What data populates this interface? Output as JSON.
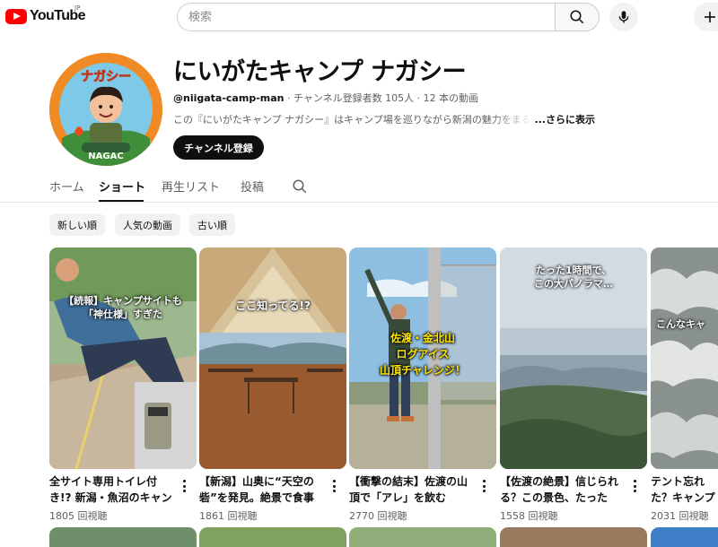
{
  "topbar": {
    "logo_text": "YouTube",
    "region": "JP",
    "search_placeholder": "検索"
  },
  "channel": {
    "name": "にいがたキャンプ ナガシー",
    "handle": "@niigata-camp-man",
    "stats": " ‧ チャンネル登録者数 105人 ‧ 12 本の動画",
    "description": "この『にいがたキャンプ ナガシー』はキャンプ場を巡りながら新潟の魅力をまるごと",
    "more_label": "...さらに表示",
    "subscribe_label": "チャンネル登録",
    "avatar_text_top": "ナガシー",
    "avatar_text_bottom": "NAGAC"
  },
  "tabs": [
    {
      "label": "ホーム"
    },
    {
      "label": "ショート"
    },
    {
      "label": "再生リスト"
    },
    {
      "label": "投稿"
    }
  ],
  "chips": [
    {
      "label": "新しい順"
    },
    {
      "label": "人気の動画"
    },
    {
      "label": "古い順"
    }
  ],
  "shorts": [
    {
      "title": "全サイト専用トイレ付き!? 新潟・魚沼のキャンプ場",
      "views": "1805 回視聴",
      "caption": "【続報】キャンプサイトも\n「神仕様」すぎた"
    },
    {
      "title": "【新潟】山奥に“天空の砦”を発見。絶景で食事",
      "views": "1861 回視聴",
      "caption": "ここ知ってる!?"
    },
    {
      "title": "【衝撃の結末】佐渡の山頂で「アレ」を飲む",
      "views": "2770 回視聴",
      "caption": "佐渡・金北山\nログアイス\n山頂チャレンジ！"
    },
    {
      "title": "【佐渡の絶景】信じられる？この景色、たった",
      "views": "1558 回視聴",
      "caption": "たった1時間で、\nこの大パノラマ…"
    },
    {
      "title": "テント忘れた？キャンプ人生、終わ",
      "views": "2031 回視聴",
      "caption": "こんなキャ"
    }
  ],
  "colors": {
    "brand_red": "#ff0000",
    "text_primary": "#0f0f0f",
    "text_secondary": "#606060",
    "chip_bg": "#f2f2f2"
  }
}
